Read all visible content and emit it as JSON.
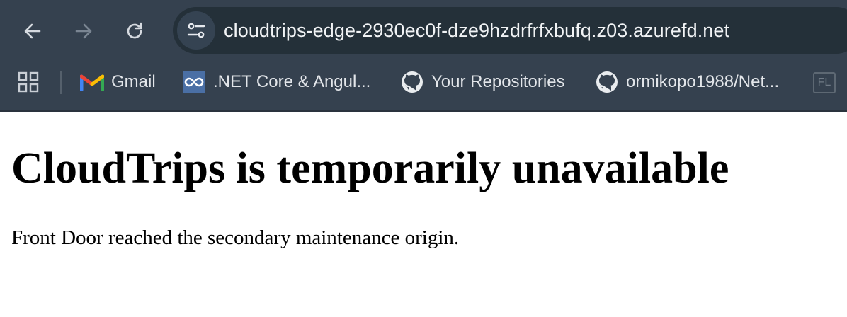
{
  "browser": {
    "address_bar": {
      "url": "cloudtrips-edge-2930ec0f-dze9hzdrfrfxbufq.z03.azurefd.net"
    },
    "bookmarks": [
      {
        "label": "Gmail",
        "icon": "gmail-icon"
      },
      {
        "label": ".NET Core & Angul...",
        "icon": "infinity-icon"
      },
      {
        "label": "Your Repositories",
        "icon": "github-icon"
      },
      {
        "label": "ormikopo1988/Net...",
        "icon": "github-icon"
      }
    ],
    "overflow_bookmark_glyph": "FL"
  },
  "page": {
    "heading": "CloudTrips is temporarily unavailable",
    "message": "Front Door reached the secondary maintenance origin."
  },
  "colors": {
    "chrome_background": "#35414f",
    "omnibox_background": "#243039",
    "page_background": "#ffffff"
  }
}
